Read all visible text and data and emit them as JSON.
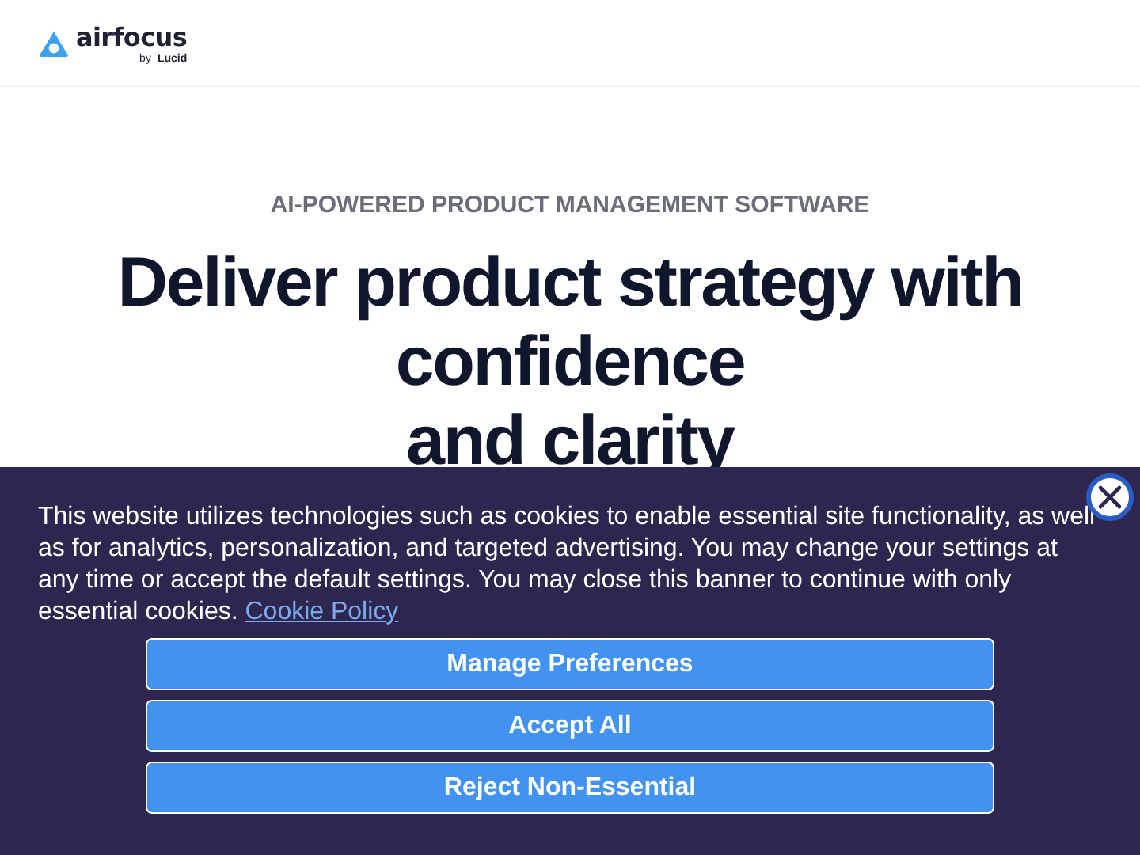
{
  "header": {
    "logo": {
      "name": "airfocus",
      "byline": "by",
      "partner": "Lucid"
    }
  },
  "hero": {
    "eyebrow": "AI-POWERED PRODUCT MANAGEMENT SOFTWARE",
    "title_lines": [
      "Deliver product strategy with",
      "confidence",
      "and clarity"
    ]
  },
  "cookie_banner": {
    "text": "This website utilizes technologies such as cookies to enable essential site functionality, as well as for analytics, personalization, and targeted advertising. You may change your settings at any time or accept the default settings. You may close this banner to continue with only essential cookies.",
    "link": "Cookie Policy",
    "buttons": [
      "Manage Preferences",
      "Accept All",
      "Reject Non-Essential"
    ]
  }
}
